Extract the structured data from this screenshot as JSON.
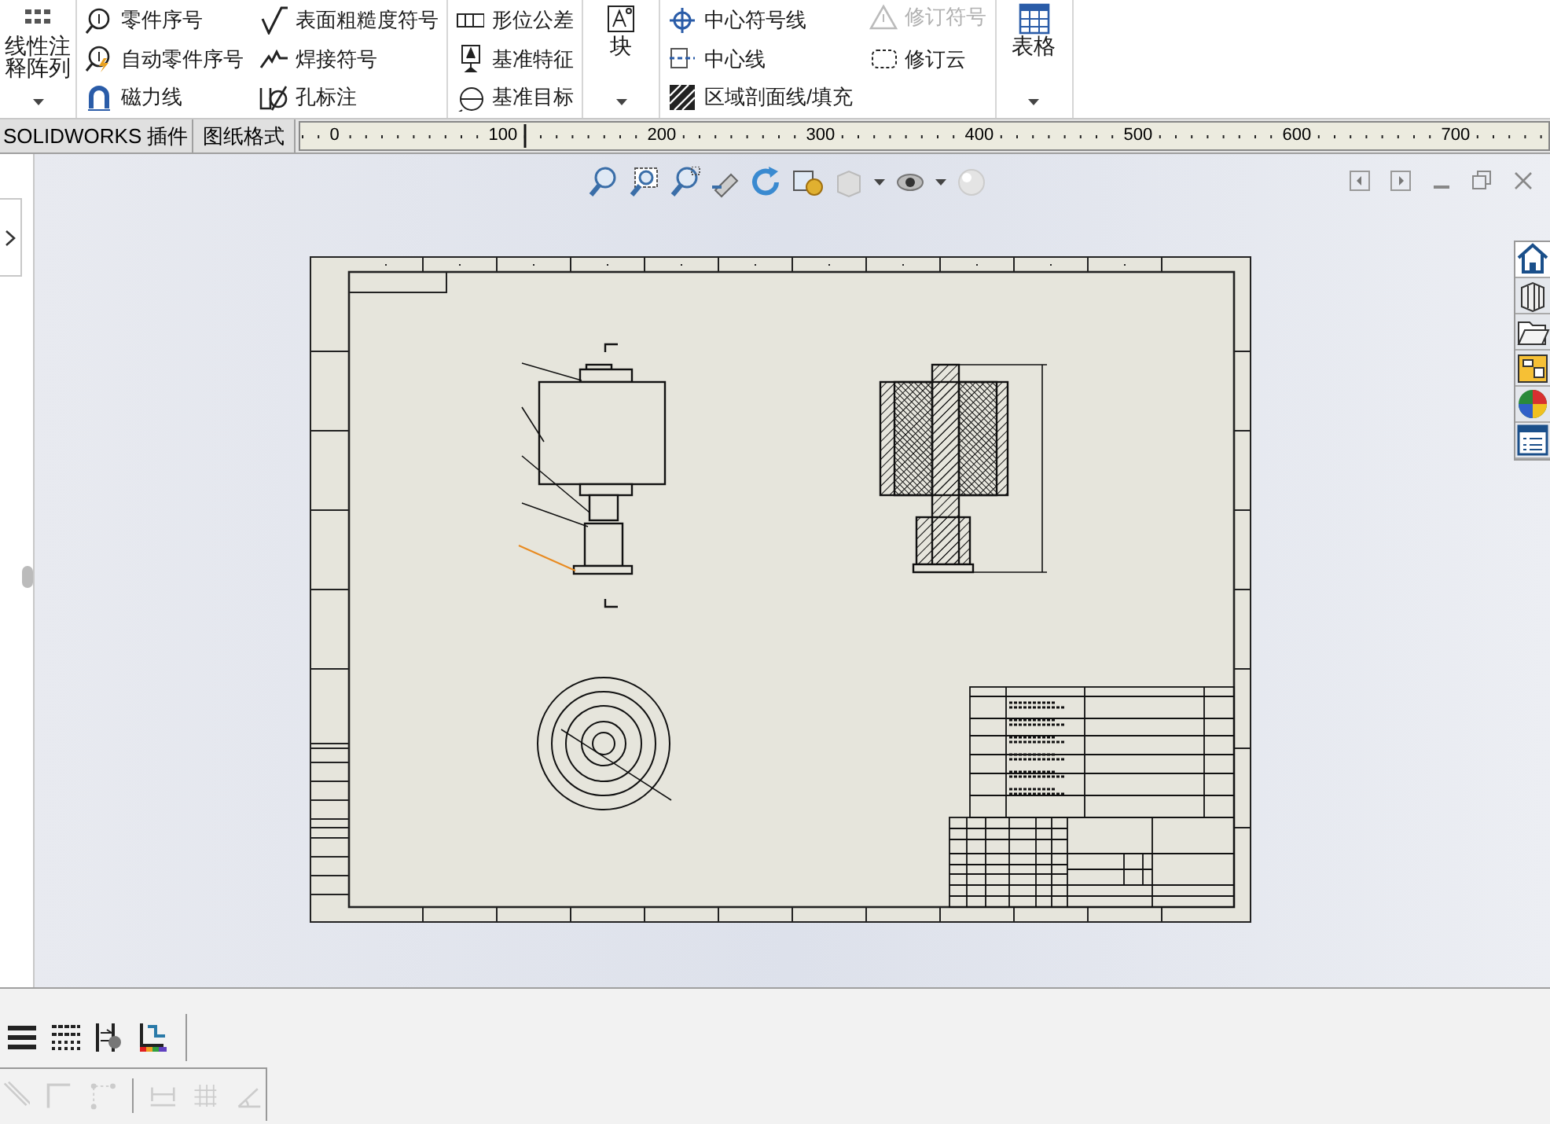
{
  "ribbon": {
    "groups": [
      {
        "kind": "large",
        "label": "线性注释阵列",
        "dropdown": true
      },
      {
        "kind": "list",
        "items": [
          {
            "label": "零件序号",
            "disabled": false
          },
          {
            "label": "自动零件序号",
            "disabled": false
          },
          {
            "label": "磁力线",
            "disabled": false
          }
        ]
      },
      {
        "kind": "list",
        "items": [
          {
            "label": "表面粗糙度符号",
            "disabled": false
          },
          {
            "label": "焊接符号",
            "disabled": false
          },
          {
            "label": "孔标注",
            "disabled": false
          }
        ]
      },
      {
        "kind": "list",
        "items": [
          {
            "label": "形位公差",
            "disabled": false
          },
          {
            "label": "基准特征",
            "disabled": false
          },
          {
            "label": "基准目标",
            "disabled": false
          }
        ]
      },
      {
        "kind": "large",
        "label": "块",
        "dropdown": true
      },
      {
        "kind": "list",
        "items": [
          {
            "label": "中心符号线",
            "disabled": false
          },
          {
            "label": "中心线",
            "disabled": false
          },
          {
            "label": "区域剖面线/填充",
            "disabled": false
          }
        ]
      },
      {
        "kind": "list",
        "items": [
          {
            "label": "修订符号",
            "disabled": true
          },
          {
            "label": "修订云",
            "disabled": false
          }
        ]
      },
      {
        "kind": "large",
        "label": "表格",
        "dropdown": true
      }
    ]
  },
  "tabs": [
    {
      "label": "SOLIDWORKS 插件",
      "selected": false
    },
    {
      "label": "图纸格式",
      "selected": false
    }
  ],
  "task_pane": {
    "tabs": [
      {
        "selected": true
      },
      {
        "selected": false
      },
      {
        "selected": false
      },
      {
        "selected": false
      },
      {
        "selected": false
      },
      {
        "selected": false
      }
    ]
  },
  "ruler": {
    "labels": [
      "0",
      "100",
      "200",
      "300",
      "400",
      "500",
      "600",
      "700"
    ]
  }
}
